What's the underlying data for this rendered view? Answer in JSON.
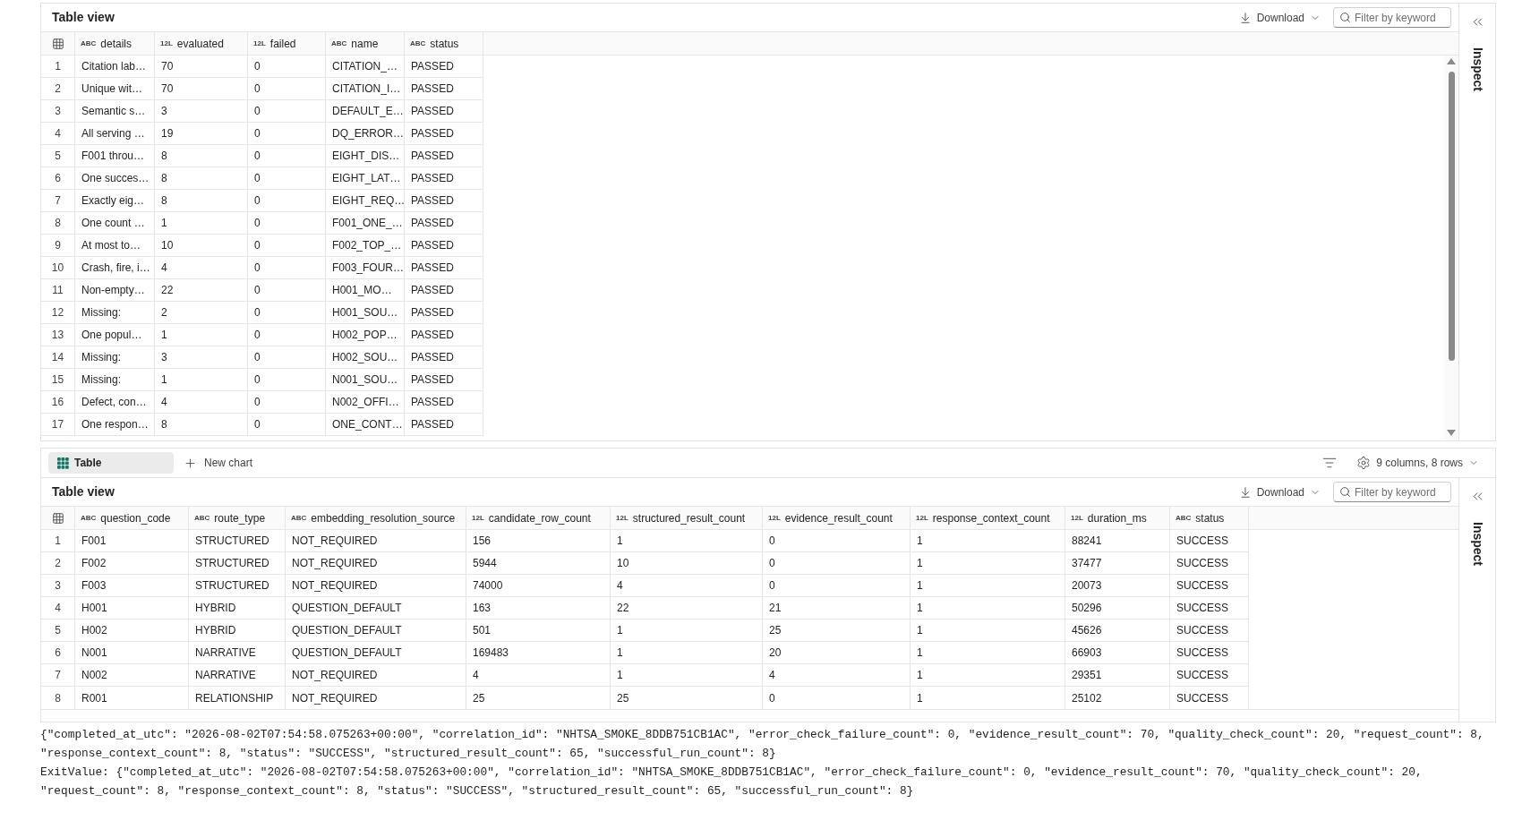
{
  "results_panel": {
    "title": "Table view",
    "download_label": "Download",
    "filter": {
      "placeholder": "Filter by keyword"
    },
    "inspect_label": "Inspect",
    "table": {
      "columns": [
        {
          "type_label": "ABC",
          "name": "details"
        },
        {
          "type_label": "12L",
          "name": "evaluated"
        },
        {
          "type_label": "12L",
          "name": "failed"
        },
        {
          "type_label": "ABC",
          "name": "name"
        },
        {
          "type_label": "ABC",
          "name": "status"
        }
      ],
      "rows": [
        {
          "row_number": "1",
          "cells": [
            "Citation lab…",
            "70",
            "0",
            "CITATION_…",
            "PASSED"
          ]
        },
        {
          "row_number": "2",
          "cells": [
            "Unique wit…",
            "70",
            "0",
            "CITATION_I…",
            "PASSED"
          ]
        },
        {
          "row_number": "3",
          "cells": [
            "Semantic s…",
            "3",
            "0",
            "DEFAULT_E…",
            "PASSED"
          ]
        },
        {
          "row_number": "4",
          "cells": [
            "All serving …",
            "19",
            "0",
            "DQ_ERROR…",
            "PASSED"
          ]
        },
        {
          "row_number": "5",
          "cells": [
            "F001 throu…",
            "8",
            "0",
            "EIGHT_DIS…",
            "PASSED"
          ]
        },
        {
          "row_number": "6",
          "cells": [
            "One succes…",
            "8",
            "0",
            "EIGHT_LAT…",
            "PASSED"
          ]
        },
        {
          "row_number": "7",
          "cells": [
            "Exactly eig…",
            "8",
            "0",
            "EIGHT_REQ…",
            "PASSED"
          ]
        },
        {
          "row_number": "8",
          "cells": [
            "One count …",
            "1",
            "0",
            "F001_ONE_…",
            "PASSED"
          ]
        },
        {
          "row_number": "9",
          "cells": [
            "At most to…",
            "10",
            "0",
            "F002_TOP_…",
            "PASSED"
          ]
        },
        {
          "row_number": "10",
          "cells": [
            "Crash, fire, i…",
            "4",
            "0",
            "F003_FOUR…",
            "PASSED"
          ]
        },
        {
          "row_number": "11",
          "cells": [
            "Non-empty…",
            "22",
            "0",
            "H001_MO…",
            "PASSED"
          ]
        },
        {
          "row_number": "12",
          "cells": [
            "Missing:",
            "2",
            "0",
            "H001_SOU…",
            "PASSED"
          ]
        },
        {
          "row_number": "13",
          "cells": [
            "One popul…",
            "1",
            "0",
            "H002_POP…",
            "PASSED"
          ]
        },
        {
          "row_number": "14",
          "cells": [
            "Missing:",
            "3",
            "0",
            "H002_SOU…",
            "PASSED"
          ]
        },
        {
          "row_number": "15",
          "cells": [
            "Missing:",
            "1",
            "0",
            "N001_SOU…",
            "PASSED"
          ]
        },
        {
          "row_number": "16",
          "cells": [
            "Defect, con…",
            "4",
            "0",
            "N002_OFFI…",
            "PASSED"
          ]
        },
        {
          "row_number": "17",
          "cells": [
            "One respon…",
            "8",
            "0",
            "ONE_CONT…",
            "PASSED"
          ]
        }
      ]
    }
  },
  "view_toolbar": {
    "tabs": [
      {
        "label": "Table",
        "selected": true
      }
    ],
    "new_chart_label": "New chart",
    "summary": "9 columns, 8 rows"
  },
  "run_panel": {
    "title": "Table view",
    "download_label": "Download",
    "filter": {
      "placeholder": "Filter by keyword"
    },
    "inspect_label": "Inspect",
    "table": {
      "columns": [
        {
          "type_label": "ABC",
          "name": "question_code"
        },
        {
          "type_label": "ABC",
          "name": "route_type"
        },
        {
          "type_label": "ABC",
          "name": "embedding_resolution_source"
        },
        {
          "type_label": "12L",
          "name": "candidate_row_count"
        },
        {
          "type_label": "12L",
          "name": "structured_result_count"
        },
        {
          "type_label": "12L",
          "name": "evidence_result_count"
        },
        {
          "type_label": "12L",
          "name": "response_context_count"
        },
        {
          "type_label": "12L",
          "name": "duration_ms"
        },
        {
          "type_label": "ABC",
          "name": "status"
        }
      ],
      "rows": [
        {
          "row_number": "1",
          "cells": [
            "F001",
            "STRUCTURED",
            "NOT_REQUIRED",
            "156",
            "1",
            "0",
            "1",
            "88241",
            "SUCCESS"
          ]
        },
        {
          "row_number": "2",
          "cells": [
            "F002",
            "STRUCTURED",
            "NOT_REQUIRED",
            "5944",
            "10",
            "0",
            "1",
            "37477",
            "SUCCESS"
          ]
        },
        {
          "row_number": "3",
          "cells": [
            "F003",
            "STRUCTURED",
            "NOT_REQUIRED",
            "74000",
            "4",
            "0",
            "1",
            "20073",
            "SUCCESS"
          ]
        },
        {
          "row_number": "4",
          "cells": [
            "H001",
            "HYBRID",
            "QUESTION_DEFAULT",
            "163",
            "22",
            "21",
            "1",
            "50296",
            "SUCCESS"
          ]
        },
        {
          "row_number": "5",
          "cells": [
            "H002",
            "HYBRID",
            "QUESTION_DEFAULT",
            "501",
            "1",
            "25",
            "1",
            "45626",
            "SUCCESS"
          ]
        },
        {
          "row_number": "6",
          "cells": [
            "N001",
            "NARRATIVE",
            "QUESTION_DEFAULT",
            "169483",
            "1",
            "20",
            "1",
            "66903",
            "SUCCESS"
          ]
        },
        {
          "row_number": "7",
          "cells": [
            "N002",
            "NARRATIVE",
            "NOT_REQUIRED",
            "4",
            "1",
            "4",
            "1",
            "29351",
            "SUCCESS"
          ]
        },
        {
          "row_number": "8",
          "cells": [
            "R001",
            "RELATIONSHIP",
            "NOT_REQUIRED",
            "25",
            "25",
            "0",
            "1",
            "25102",
            "SUCCESS"
          ]
        }
      ]
    }
  },
  "output_lines": [
    "{\"completed_at_utc\": \"2026-08-02T07:54:58.075263+00:00\", \"correlation_id\": \"NHTSA_SMOKE_8DDB751CB1AC\", \"error_check_failure_count\": 0, \"evidence_result_count\": 70, \"quality_check_count\": 20, \"request_count\": 8,",
    "\"response_context_count\": 8, \"status\": \"SUCCESS\", \"structured_result_count\": 65, \"successful_run_count\": 8}",
    "ExitValue: {\"completed_at_utc\": \"2026-08-02T07:54:58.075263+00:00\", \"correlation_id\": \"NHTSA_SMOKE_8DDB751CB1AC\", \"error_check_failure_count\": 0, \"evidence_result_count\": 70, \"quality_check_count\": 20,",
    "\"request_count\": 8, \"response_context_count\": 8, \"status\": \"SUCCESS\", \"structured_result_count\": 65, \"successful_run_count\": 8}"
  ]
}
